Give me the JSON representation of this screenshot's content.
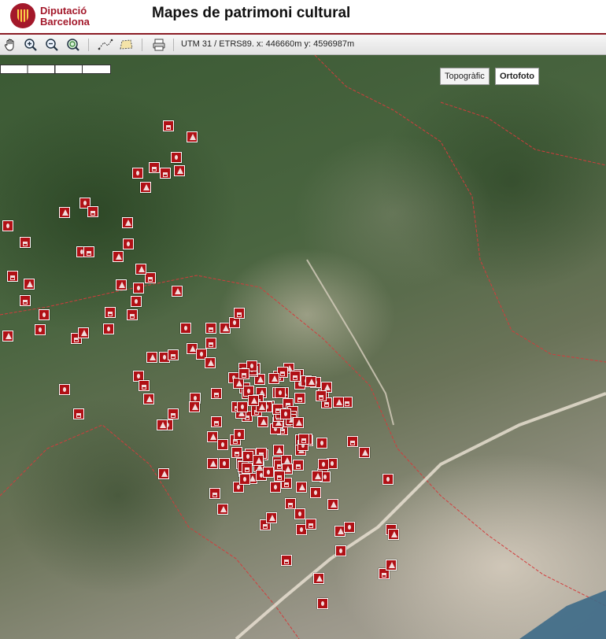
{
  "header": {
    "logo_line1": "Diputació",
    "logo_line2": "Barcelona",
    "title": "Mapes de patrimoni cultural"
  },
  "toolbar": {
    "tools": [
      "hand-pan-icon",
      "zoom-in-icon",
      "zoom-out-icon",
      "zoom-extent-icon",
      "measure-distance-icon",
      "measure-area-icon",
      "print-icon"
    ],
    "coordinates": "UTM 31 / ETRS89. x: 446660m y: 4596987m"
  },
  "map": {
    "layer_buttons": {
      "topographic": "Topogràfic",
      "orthophoto": "Ortofoto"
    },
    "active_layer": "Ortofoto",
    "marker_color": "#b01015",
    "boundary_color": "#d23c3c"
  }
}
